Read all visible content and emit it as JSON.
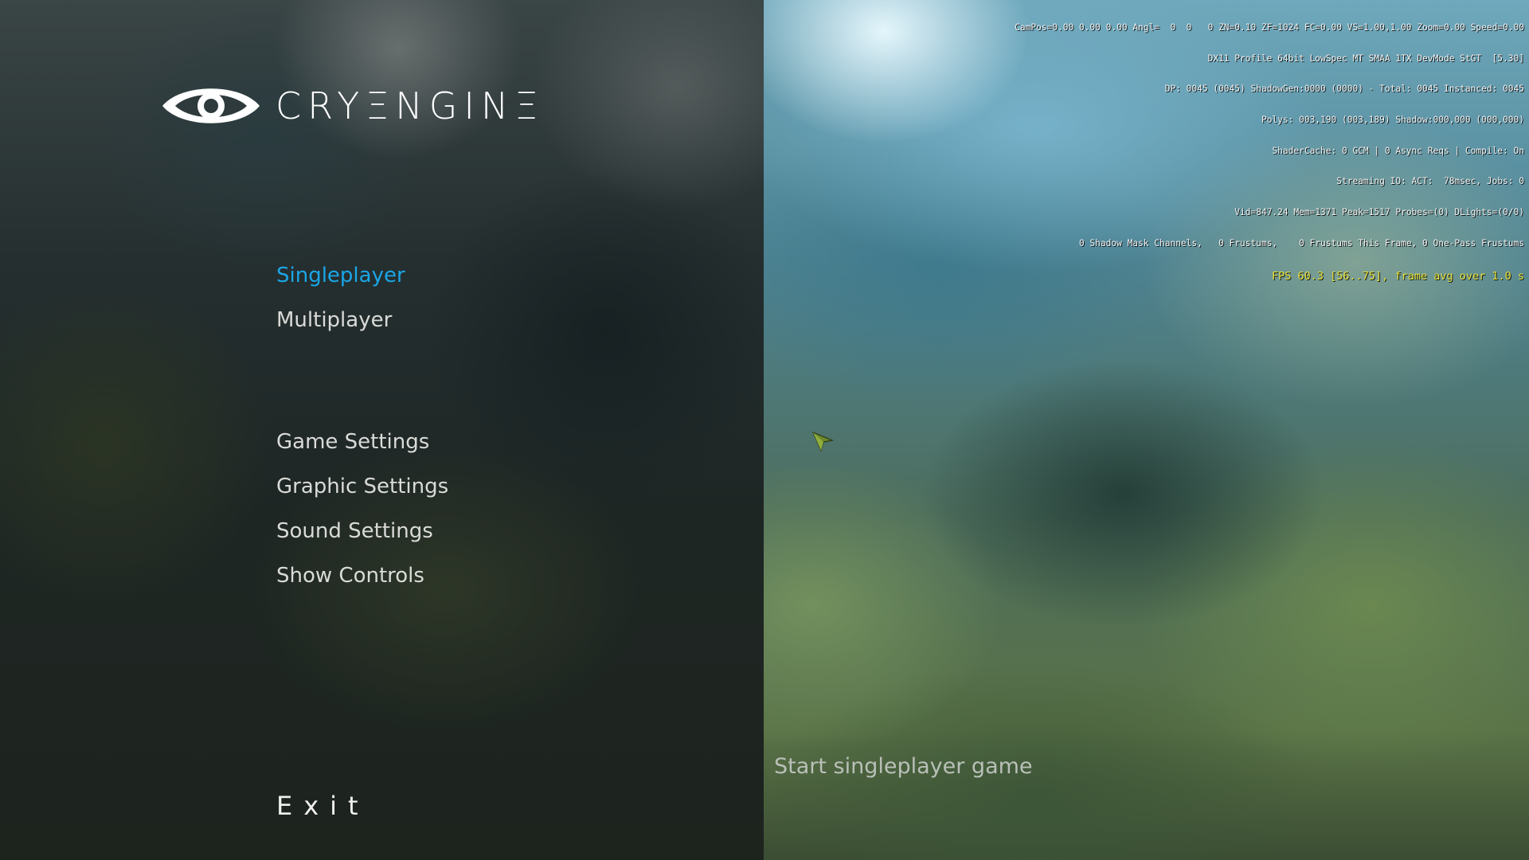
{
  "logo": {
    "text": "CRYΞNGINΞ"
  },
  "menu": {
    "items": [
      {
        "label": "Singleplayer"
      },
      {
        "label": "Multiplayer"
      },
      {
        "label": "Game Settings"
      },
      {
        "label": "Graphic Settings"
      },
      {
        "label": "Sound Settings"
      },
      {
        "label": "Show Controls"
      }
    ],
    "exit_label": "Exit",
    "active_item": "Singleplayer",
    "active_color": "#1aa6e6"
  },
  "description": "Start singleplayer game",
  "debug": {
    "lines": [
      "CamPos=0.00 0.00 0.00 Angl=  0  0   0 ZN=0.10 ZF=1024 FC=0.00 VS=1.00,1.00 Zoom=0.00 Speed=0.00",
      "DX11 Profile 64bit LowSpec MT SMAA 1TX DevMode StGT  [5.30]",
      "DP: 0045 (0045) ShadowGen:0000 (0000) - Total: 0045 Instanced: 0045",
      "Polys: 003,190 (003,189) Shadow:000,000 (000,000)",
      "ShaderCache: 0 GCM | 0 Async Reqs | Compile: On",
      "Streaming IO: ACT:  78msec, Jobs: 0",
      "Vid=847.24 Mem=1371 Peak=1517 Probes=(0) DLights=(0/0)",
      "0 Shadow Mask Channels,   0 Frustums,    0 Frustums This Frame, 0 One-Pass Frustums"
    ],
    "fps": "FPS 60.3 [56..75], frame avg over 1.0 s",
    "fps_color": "#e8e23a"
  },
  "icons": {
    "logo": "cryengine-eye-icon",
    "cursor": "mouse-cursor-icon"
  }
}
